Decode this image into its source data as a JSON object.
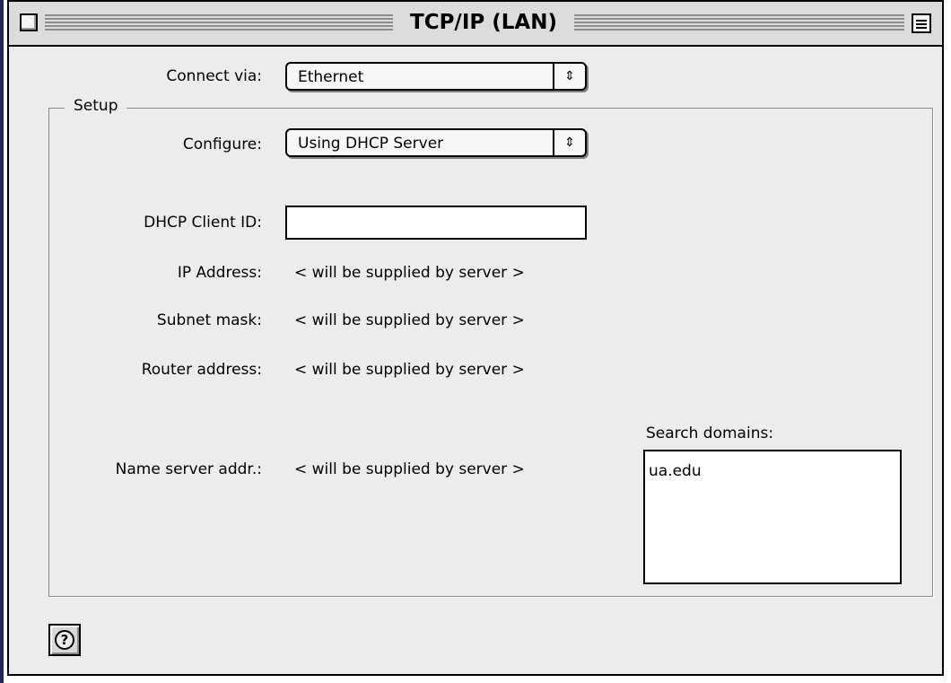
{
  "window": {
    "title": "TCP/IP (LAN)"
  },
  "connect_via": {
    "label": "Connect via:",
    "value": "Ethernet"
  },
  "setup": {
    "group_title": "Setup",
    "configure": {
      "label": "Configure:",
      "value": "Using DHCP Server"
    },
    "dhcp_client_id": {
      "label": "DHCP Client ID:",
      "value": ""
    },
    "ip_address": {
      "label": "IP Address:",
      "value": "< will be supplied by server >"
    },
    "subnet_mask": {
      "label": "Subnet mask:",
      "value": "< will be supplied by server >"
    },
    "router_address": {
      "label": "Router address:",
      "value": "< will be supplied by server >"
    },
    "name_server": {
      "label": "Name server addr.:",
      "value": "< will be supplied by server >"
    },
    "search_domains": {
      "label": "Search domains:",
      "value": "ua.edu"
    }
  },
  "help_button": {
    "glyph": "?"
  },
  "popup_arrows_glyph": "⇕",
  "icons": {
    "close": "close-box-icon",
    "collapse": "window-collapse-icon",
    "help": "help-icon"
  },
  "colors": {
    "window_background": "#ececec",
    "title_bar": "#dcdcdc",
    "left_accent": "#26265e"
  }
}
